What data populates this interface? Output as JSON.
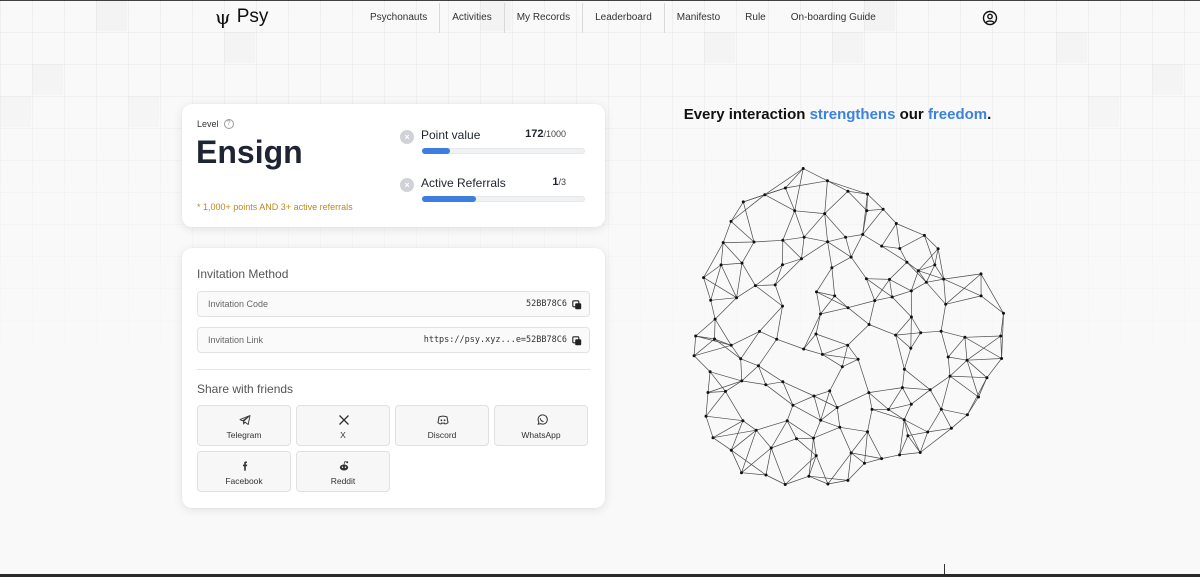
{
  "brand": {
    "logo_glyph": "ψ",
    "name": "Psy"
  },
  "nav": {
    "items": [
      {
        "label": "Psychonauts"
      },
      {
        "label": "Activities"
      },
      {
        "label": "My Records"
      },
      {
        "label": "Leaderboard"
      },
      {
        "label": "Manifesto"
      },
      {
        "label": "Rule"
      },
      {
        "label": "On-boarding Guide"
      }
    ],
    "user_icon": "user-circle-icon"
  },
  "level_card": {
    "label": "Level",
    "help_icon": "question-circle-icon",
    "name": "Ensign",
    "requirement": "* 1,000+ points AND 3+ active referrals",
    "point_value": {
      "label": "Point value",
      "current": "172",
      "max": "/1000",
      "progress": 0.172
    },
    "active_referrals": {
      "label": "Active Referrals",
      "current": "1",
      "max": "/3",
      "progress": 0.3333
    }
  },
  "invite_card": {
    "title": "Invitation Method",
    "code_label": "Invitation Code",
    "code_value": "52BB78C6",
    "link_label": "Invitation Link",
    "link_value": "https://psy.xyz...e=52BB78C6",
    "share_title": "Share with friends",
    "share": {
      "telegram": "Telegram",
      "x": "X",
      "discord": "Discord",
      "whatsapp": "WhatsApp",
      "facebook": "Facebook",
      "reddit": "Reddit"
    }
  },
  "hero": {
    "part1": "Every interaction ",
    "highlight1": "strengthens",
    "part2": " our ",
    "highlight2": "freedom",
    "part3": "."
  },
  "colors": {
    "accent": "#3b7de0",
    "highlight": "#3b82e0",
    "note": "#b98a1e"
  }
}
